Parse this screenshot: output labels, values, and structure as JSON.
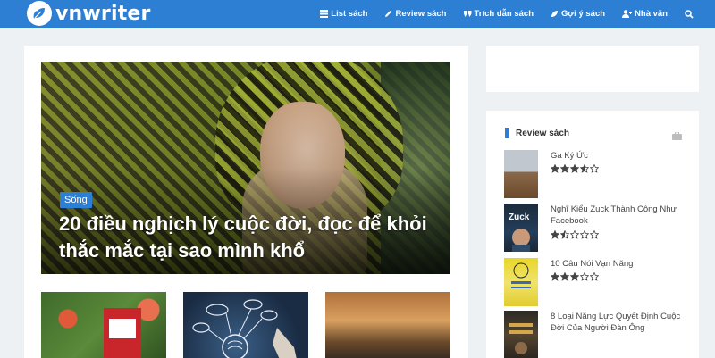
{
  "brand": {
    "name": "vnwriter",
    "logo_icon": "leaf-icon",
    "primary_color": "#2d7fd3"
  },
  "nav": {
    "items": [
      {
        "label": "List sách",
        "icon": "list-icon"
      },
      {
        "label": "Review sách",
        "icon": "pencil-icon"
      },
      {
        "label": "Trích dẫn sách",
        "icon": "quote-icon"
      },
      {
        "label": "Gợi ý sách",
        "icon": "leaf-icon"
      },
      {
        "label": "Nhà văn",
        "icon": "users-icon"
      }
    ],
    "search_icon": "search-icon"
  },
  "featured": {
    "category": "Sống",
    "title": "20 điều nghịch lý cuộc đời, đọc để khỏi thắc mắc tại sao mình khổ"
  },
  "sidebar": {
    "widget_title": "Review sách",
    "widget_icon": "briefcase-icon",
    "books": [
      {
        "title": "Ga Ký Ức",
        "rating": 3.5,
        "max": 5
      },
      {
        "title": "Nghĩ Kiểu Zuck Thành Công Như Facebook",
        "rating": 1.5,
        "max": 5
      },
      {
        "title": "10 Câu Nói Vạn Năng",
        "rating": 3,
        "max": 5
      },
      {
        "title": "8 Loại Năng Lực Quyết Định Cuộc Đời Của Người Đàn Ông",
        "rating": null,
        "max": 5
      }
    ]
  }
}
